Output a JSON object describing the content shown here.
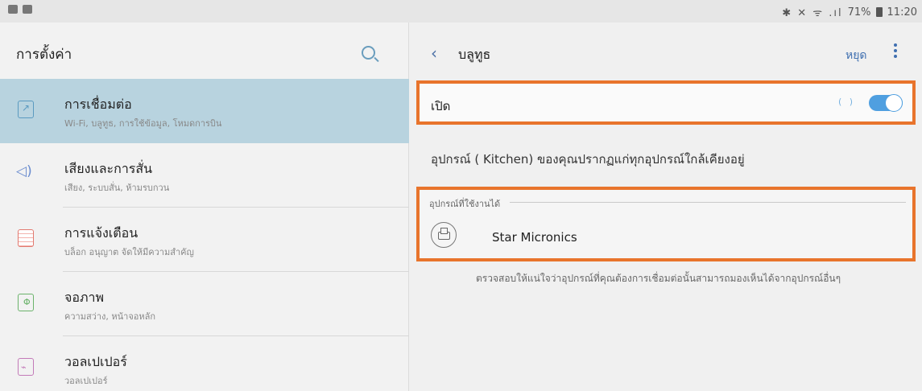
{
  "status_bar": {
    "icons": "✱ ✕ ᯤ .ıl",
    "battery": "71%",
    "time": "11:20"
  },
  "left_panel": {
    "title": "การตั้งค่า",
    "items": [
      {
        "title": "การเชื่อมต่อ",
        "subtitle": "Wi-Fi, บลูทูธ, การใช้ข้อมูล, โหมดการบิน",
        "icon": "connection-icon",
        "selected": true
      },
      {
        "title": "เสียงและการสั่น",
        "subtitle": "เสียง, ระบบสั่น, ห้ามรบกวน",
        "icon": "sound-icon"
      },
      {
        "title": "การแจ้งเตือน",
        "subtitle": "บล็อก อนุญาต จัดให้มีความสำคัญ",
        "icon": "notification-icon"
      },
      {
        "title": "จอภาพ",
        "subtitle": "ความสว่าง, หน้าจอหลัก",
        "icon": "display-icon"
      },
      {
        "title": "วอลเปเปอร์",
        "subtitle": "วอลเปเปอร์",
        "icon": "wallpaper-icon"
      }
    ]
  },
  "right_panel": {
    "title": "บลูทูธ",
    "stop_label": "หยุด",
    "on_label": "เปิด",
    "ripple": "( )",
    "toggle_on": true,
    "visible_text": "อุปกรณ์ (      Kitchen) ของคุณปรากฏแก่ทุกอุปกรณ์ใกล้เคียงอยู่",
    "available_header": "อุปกรณ์ที่ใช้งานได้",
    "devices": [
      {
        "name": "Star Micronics",
        "icon": "printer-icon"
      }
    ],
    "help_text": "ตรวจสอบให้แน่ใจว่าอุปกรณ์ที่คุณต้องการเชื่อมต่อนั้นสามารถมองเห็นได้จากอุปกรณ์อื่นๆ"
  },
  "colors": {
    "highlight_border": "#e8742c",
    "selected_item": "#b8d3df",
    "accent": "#3f6fb0"
  }
}
